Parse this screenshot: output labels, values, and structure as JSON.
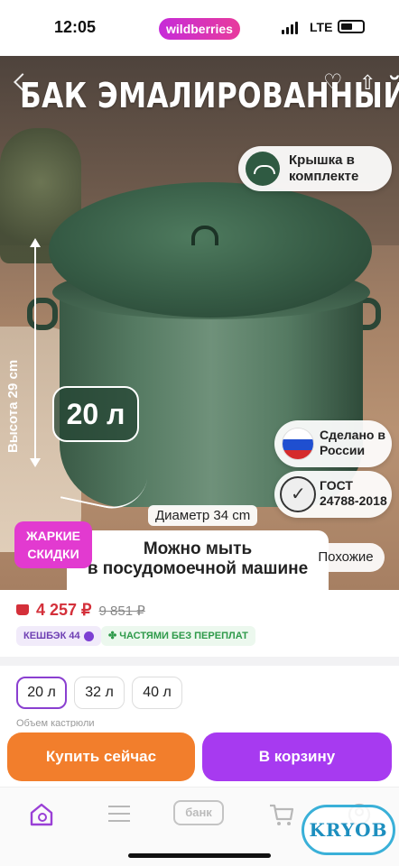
{
  "status_bar": {
    "time": "12:05",
    "app_badge": "wildberries",
    "network": "LTE"
  },
  "product": {
    "title": "БАК ЭМАЛИРОВАННЫЙ",
    "badges": {
      "lid": "Крышка в комплекте",
      "volume": "20 л",
      "height": "Высота 29 cm",
      "diameter": "Диаметр 34 cm",
      "origin": "Сделано в России",
      "gost_line1": "ГОСТ",
      "gost_line2": "24788-2018",
      "dishwasher_line1": "Можно мыть",
      "dishwasher_line2": "в посудомоечной машине"
    },
    "promo_line1": "ЖАРКИЕ",
    "promo_line2": "СКИДКИ",
    "similar_label": "Похожие"
  },
  "pricing": {
    "current": "4 257 ₽",
    "old": "9 851 ₽",
    "cashback": "КЕШБЭК 44",
    "installment": "ЧАСТЯМИ БЕЗ ПЕРЕПЛАТ",
    "colors": {
      "price": "#d4303a",
      "cashback": "#6e3fb3",
      "installment": "#2e9a4a"
    }
  },
  "sizes": {
    "options": [
      "20 л",
      "32 л",
      "40 л"
    ],
    "selected": "20 л",
    "caption": "Объем кастрюли"
  },
  "actions": {
    "buy_now": "Купить сейчас",
    "add_to_cart": "В корзину",
    "colors": {
      "buy": "#f27e2c",
      "cart": "#a73af0"
    }
  },
  "bottom_nav": {
    "items": [
      {
        "icon": "home-search-icon",
        "active": true
      },
      {
        "icon": "menu-icon"
      },
      {
        "label": "банк"
      },
      {
        "icon": "cart-icon"
      },
      {
        "icon": "profile-icon"
      }
    ],
    "accent": "#9a3fd6"
  },
  "watermark": "KRYOB"
}
